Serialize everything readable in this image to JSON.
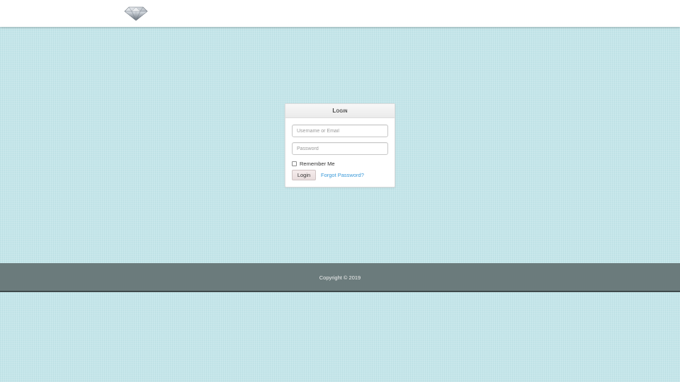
{
  "header": {
    "logo_icon": "diamond-icon"
  },
  "login": {
    "title": "Login",
    "username_placeholder": "Username or Email",
    "username_value": "",
    "password_placeholder": "Password",
    "password_value": "",
    "remember_label": "Remember Me",
    "remember_checked": false,
    "submit_label": "Login",
    "forgot_label": "Forgot Password?"
  },
  "footer": {
    "copyright": "Copyright © 2019"
  },
  "colors": {
    "background": "#c5e6ea",
    "header": "#ffffff",
    "footer": "#6b7b7c",
    "link": "#3a9ad9"
  }
}
